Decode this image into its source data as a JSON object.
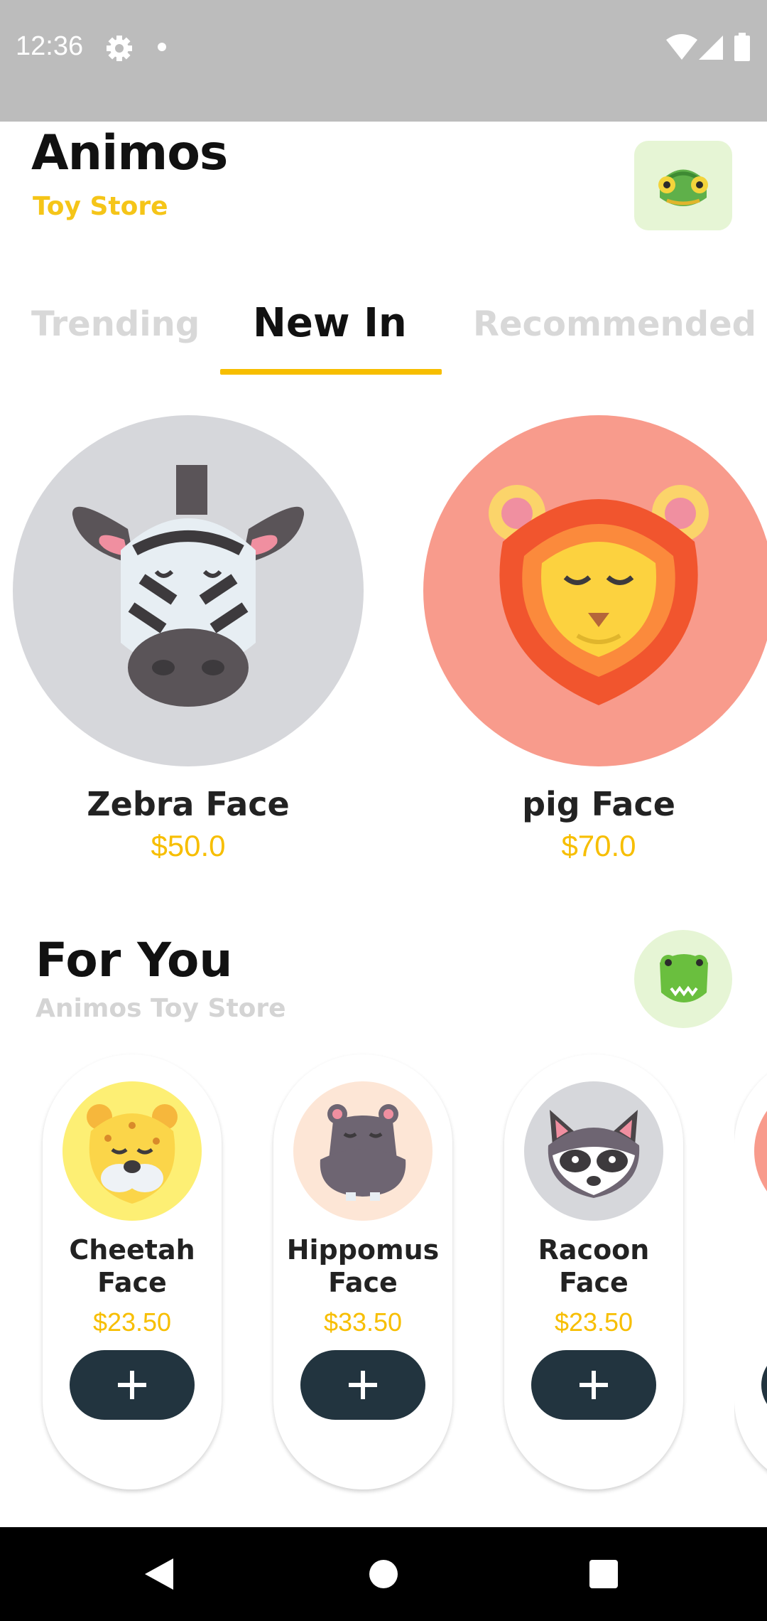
{
  "status_bar": {
    "time": "12:36"
  },
  "header": {
    "title": "Animos",
    "subtitle": "Toy Store"
  },
  "tabs": [
    {
      "label": "Trending",
      "active": false
    },
    {
      "label": "New In",
      "active": true
    },
    {
      "label": "Recommended",
      "active": false
    }
  ],
  "featured": [
    {
      "name": "Zebra Face",
      "price": "$50.0",
      "bg": "#d6d7db"
    },
    {
      "name": "pig Face",
      "price": "$70.0",
      "bg": "#f89b8c"
    }
  ],
  "for_you": {
    "title": "For You",
    "subtitle": "Animos Toy Store",
    "items": [
      {
        "name_line1": "Cheetah",
        "name_line2": "Face",
        "price": "$23.50",
        "bg": "#fdef74"
      },
      {
        "name_line1": "Hippomus",
        "name_line2": "Face",
        "price": "$33.50",
        "bg": "#fde6d6"
      },
      {
        "name_line1": "Racoon",
        "name_line2": "Face",
        "price": "$23.50",
        "bg": "#d6d7db"
      }
    ]
  },
  "colors": {
    "accent": "#f7be00",
    "button": "#22343f",
    "status_bar": "#bcbcbc"
  }
}
